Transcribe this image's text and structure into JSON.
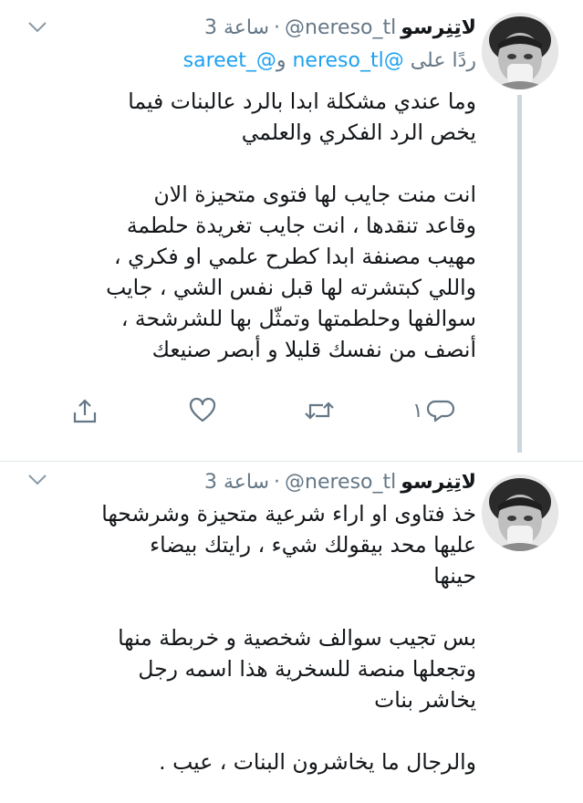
{
  "tweets": [
    {
      "name": "لاتِنِرسو",
      "handle": "@nereso_tl",
      "separator": "·",
      "time": "3 ساعة",
      "reply_prefix": "ردًا على",
      "reply_mention_1": "@nereso_tl",
      "reply_joiner": "و",
      "reply_mention_2": "@_sareet",
      "lines": [
        "وما عندي مشكلة ابدا بالرد عالبنات فيما",
        "يخص الرد الفكري والعلمي",
        "",
        "انت منت جايب لها فتوى متحيزة الان",
        "وقاعد تنقدها ، انت جايب تغريدة حلطمة",
        "مهيب مصنفة ابدا كطرح علمي او فكري ،",
        "واللي كبتشرته لها قبل نفس الشي ، جايب",
        "سوالفها وحلطمتها وتمثّل بها للشرشحة ،",
        "أنصف من نفسك قليلا و أبصر صنيعك"
      ],
      "reply_count": "١"
    },
    {
      "name": "لاتِنِرسو",
      "handle": "@nereso_tl",
      "separator": "·",
      "time": "3 ساعة",
      "lines": [
        "خذ فتاوى او اراء شرعية متحيزة وشرشحها",
        "عليها محد بيقولك شيء ، رايتك بيضاء",
        "حينها",
        "",
        "بس تجيب سوالف شخصية و خربطة منها",
        "وتجعلها منصة للسخرية هذا اسمه رجل",
        "يخاشر بنات",
        "",
        "والرجال ما يخاشرون البنات ، عيب ."
      ]
    }
  ],
  "icons": {
    "reply": "reply-icon",
    "retweet": "retweet-icon",
    "like": "like-icon",
    "share": "share-icon",
    "more": "chevron-down-icon"
  },
  "colors": {
    "text": "#14171a",
    "secondary": "#657786",
    "link": "#1da1f2",
    "thread_line": "#ccd6dd",
    "divider": "#e1e8ed"
  }
}
